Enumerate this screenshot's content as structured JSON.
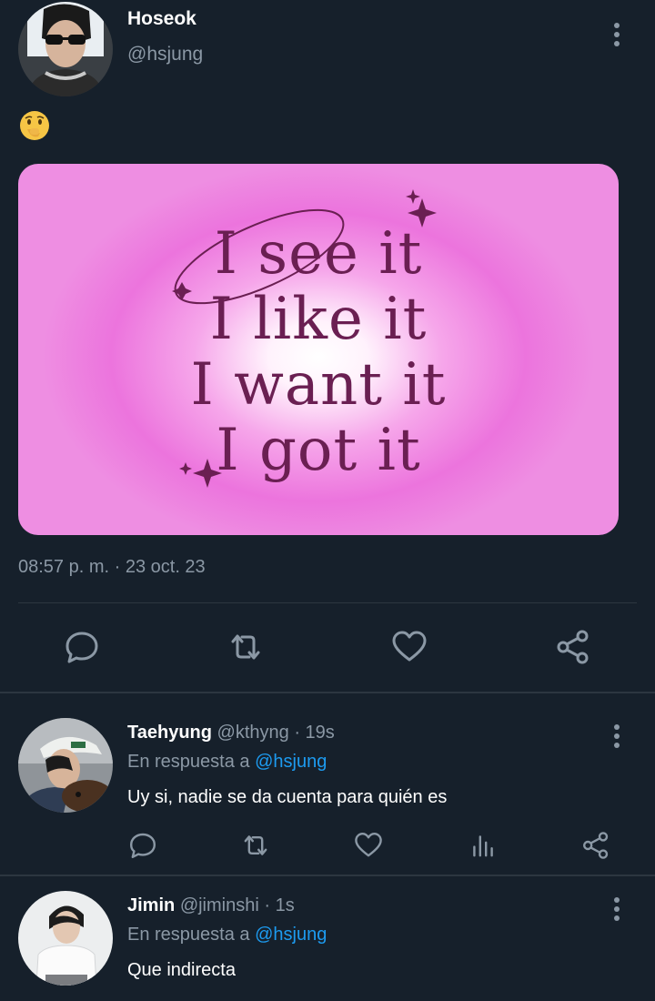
{
  "tweet": {
    "author_name": "Hoseok",
    "author_handle": "@hsjung",
    "emoji": "🫢",
    "image_text": [
      "I see it",
      "I like it",
      "I want it",
      "I got it"
    ],
    "timestamp": "08:57 p. m. · 23 oct. 23",
    "actions": [
      "reply-icon",
      "retweet-icon",
      "like-icon",
      "share-icon"
    ]
  },
  "replies": [
    {
      "name": "Taehyung",
      "handle": "@kthyng",
      "time": "· 19s",
      "reply_prefix": "En respuesta a",
      "reply_mention": "@hsjung",
      "text": "Uy si, nadie se da cuenta para quién es",
      "actions": [
        "reply-icon",
        "retweet-icon",
        "like-icon",
        "analytics-icon",
        "share-icon"
      ]
    },
    {
      "name": "Jimin",
      "handle": "@jiminshi",
      "time": "· 1s",
      "reply_prefix": "En respuesta a",
      "reply_mention": "@hsjung",
      "text": "Que indirecta"
    }
  ],
  "colors": {
    "background": "#16202b",
    "secondary_text": "#8b98a5",
    "mention": "#1d9bf0",
    "image_text": "#6a1f52"
  }
}
